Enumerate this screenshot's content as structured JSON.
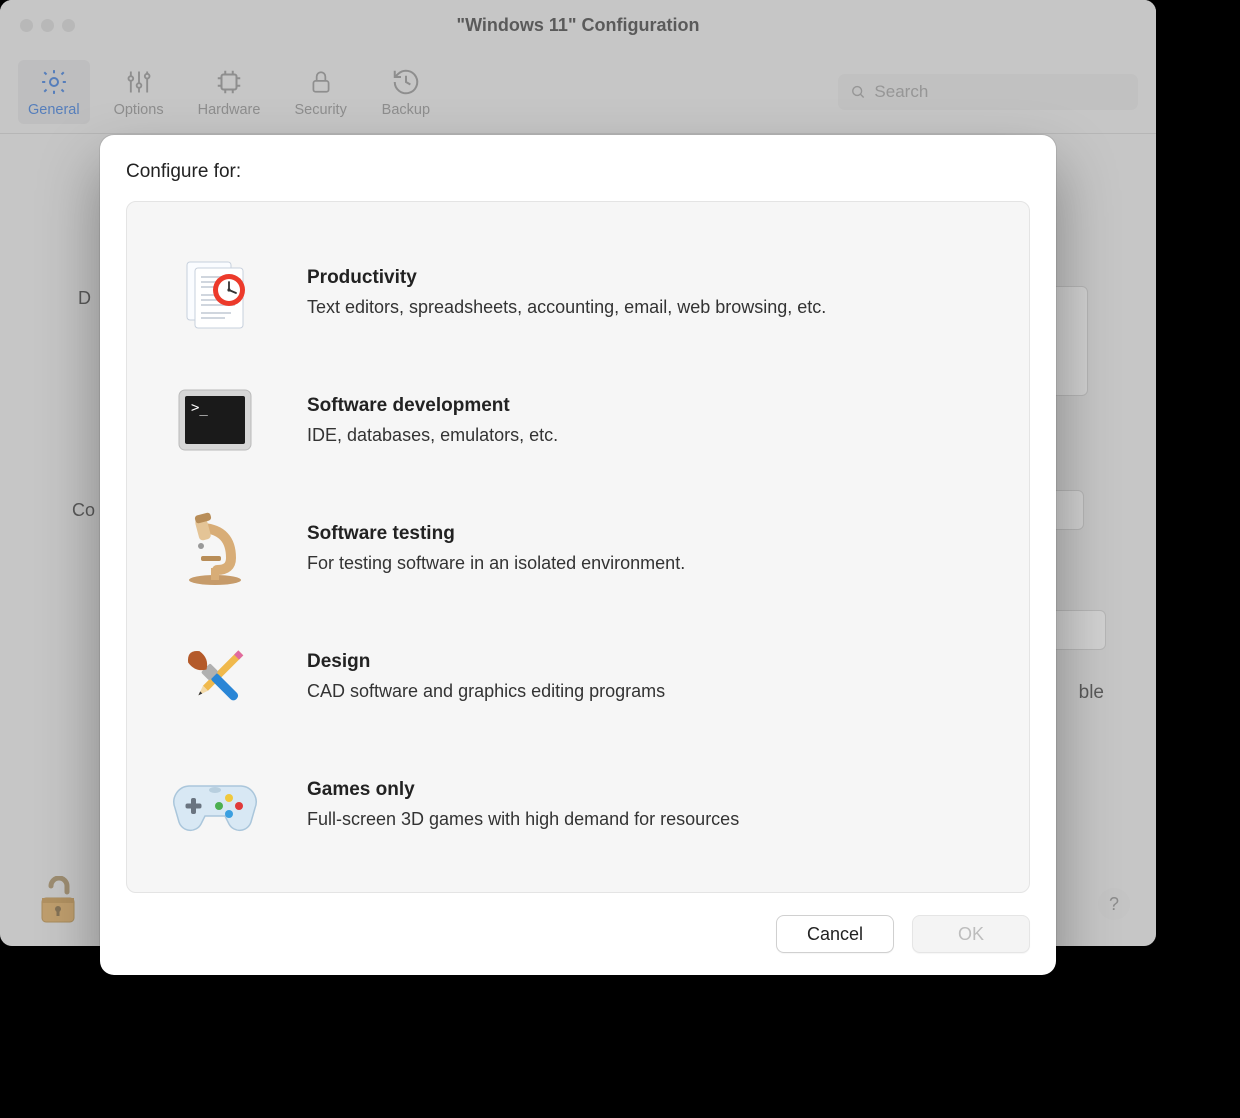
{
  "window": {
    "title": "\"Windows 11\" Configuration"
  },
  "toolbar": {
    "items": [
      {
        "label": "General"
      },
      {
        "label": "Options"
      },
      {
        "label": "Hardware"
      },
      {
        "label": "Security"
      },
      {
        "label": "Backup"
      }
    ],
    "search_placeholder": "Search"
  },
  "background_peek": {
    "d": "D",
    "co": "Co",
    "ble": "ble"
  },
  "sheet": {
    "heading": "Configure for:",
    "options": [
      {
        "title": "Productivity",
        "desc": "Text editors, spreadsheets, accounting, email, web browsing, etc."
      },
      {
        "title": "Software development",
        "desc": "IDE, databases, emulators, etc."
      },
      {
        "title": "Software testing",
        "desc": "For testing software in an isolated environment."
      },
      {
        "title": "Design",
        "desc": "CAD software and graphics editing programs"
      },
      {
        "title": "Games only",
        "desc": "Full-screen 3D games with high demand for resources"
      }
    ],
    "buttons": {
      "cancel": "Cancel",
      "ok": "OK"
    }
  },
  "help": {
    "label": "?"
  }
}
